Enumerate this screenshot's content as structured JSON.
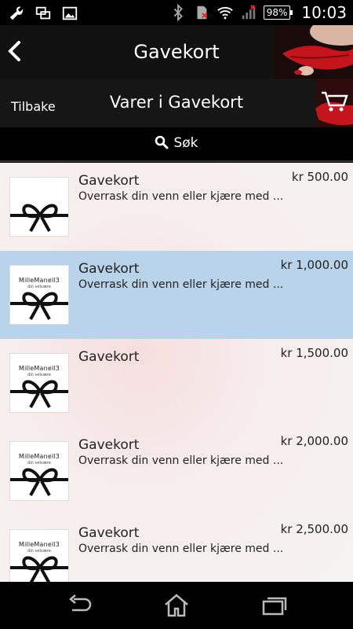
{
  "status_bar": {
    "battery": "98%",
    "time": "10:03"
  },
  "header": {
    "title": "Gavekort"
  },
  "subheader": {
    "back_label": "Tilbake",
    "title": "Varer i Gavekort"
  },
  "search": {
    "label": "Søk"
  },
  "thumbnail": {
    "brand": "MilleManell3",
    "tagline": "din velvære"
  },
  "items": [
    {
      "name": "Gavekort",
      "desc": "Overrask din venn eller kjære med ...",
      "price": "kr 500.00"
    },
    {
      "name": "Gavekort",
      "desc": "Overrask din venn eller kjære med ...",
      "price": "kr 1,000.00"
    },
    {
      "name": "Gavekort",
      "desc": "",
      "price": "kr 1,500.00"
    },
    {
      "name": "Gavekort",
      "desc": "Overrask din venn eller kjære med ...",
      "price": "kr 2,000.00"
    },
    {
      "name": "Gavekort",
      "desc": "Overrask din venn eller kjære med ...",
      "price": "kr 2,500.00"
    }
  ],
  "colors": {
    "selected_row": "#b9d3ea",
    "accent_red": "#c4141c"
  }
}
